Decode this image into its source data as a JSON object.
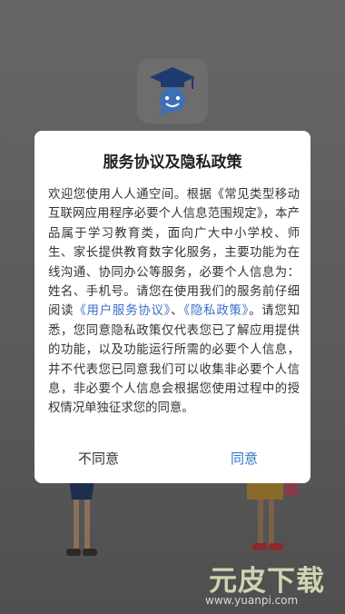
{
  "dialog": {
    "title": "服务协议及隐私政策",
    "body_part1": "欢迎您使用人人通空间。根据《常见类型移动互联网应用程序必要个人信息范围规定》，本产品属于学习教育类，面向广大中小学校、师生、家长提供教育数字化服务，主要功能为在线沟通、协同办公等服务，必要个人信息为：姓名、手机号。请您在使用我们的服务前仔细阅读",
    "link_user_agreement": "《用户服务协议》",
    "separator": "、",
    "link_privacy_policy": "《隐私政策》",
    "body_part2": "。请您知悉，您同意隐私政策仅代表您已了解应用提供的功能，以及功能运行所需的必要个人信息，并不代表您已同意我们可以收集非必要个人信息，非必要个人信息会根据您使用过程中的授权情况单独征求您的同意。",
    "disagree_label": "不同意",
    "agree_label": "同意"
  },
  "app_icon": {
    "icon": "graduation-cap-chat-icon"
  },
  "watermark": {
    "title": "元皮下载",
    "url": "www.yuanpi.com"
  },
  "colors": {
    "link": "#3b6fc9",
    "agree": "#2f74c6",
    "overlay": "#5c5c5c"
  }
}
